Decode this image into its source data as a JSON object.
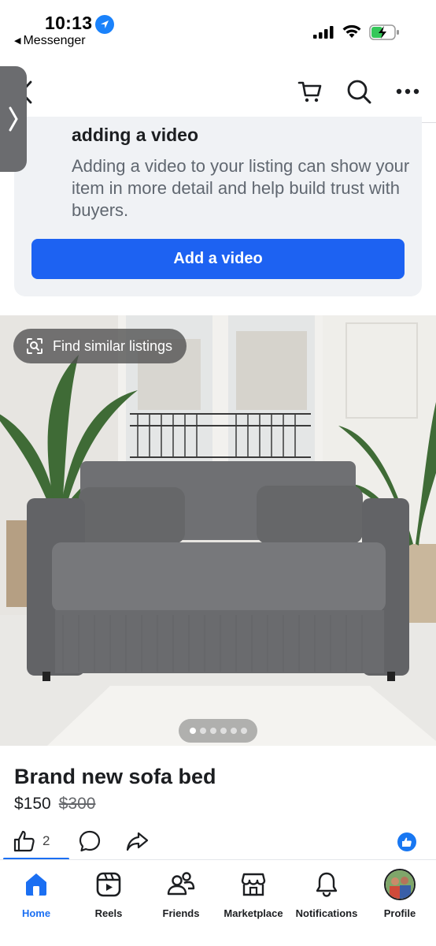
{
  "status_bar": {
    "time": "10:13",
    "back_app": "Messenger"
  },
  "video_prompt": {
    "title": "adding a video",
    "description": "Adding a video to your listing can show your item in more detail and help build trust with buyers.",
    "button_label": "Add a video"
  },
  "photo": {
    "find_similar_label": "Find similar listings",
    "total_images": 6,
    "current_image": 1
  },
  "listing": {
    "title": "Brand new sofa bed",
    "price": "$150",
    "original_price": "$300"
  },
  "reactions": {
    "like_count": "2"
  },
  "tabbar": {
    "items": [
      {
        "label": "Home",
        "icon": "home-icon",
        "active": true
      },
      {
        "label": "Reels",
        "icon": "reels-icon",
        "active": false
      },
      {
        "label": "Friends",
        "icon": "friends-icon",
        "active": false
      },
      {
        "label": "Marketplace",
        "icon": "marketplace-icon",
        "active": false
      },
      {
        "label": "Notifications",
        "icon": "bell-icon",
        "active": false
      },
      {
        "label": "Profile",
        "icon": "avatar",
        "active": false
      }
    ]
  },
  "colors": {
    "accent": "#1d62f2",
    "card_bg": "#f0f2f5",
    "text_primary": "#1c1e21",
    "text_secondary": "#606770"
  }
}
